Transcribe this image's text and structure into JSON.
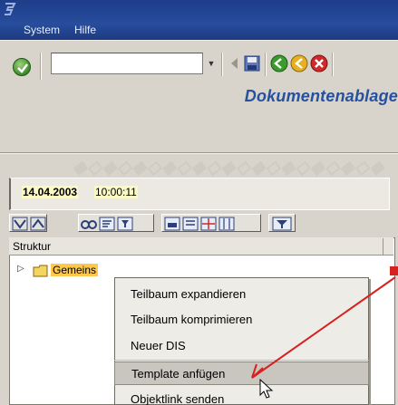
{
  "menubar": {
    "items": [
      "System",
      "Hilfe"
    ]
  },
  "toolbar": {
    "command_field_value": "",
    "buttons": [
      "enter-icon",
      "save-icon",
      "back-icon",
      "exit-icon",
      "cancel-icon"
    ]
  },
  "app": {
    "title": "Dokumentenablage"
  },
  "info": {
    "date": "14.04.2003",
    "time": "10:00:11"
  },
  "tree": {
    "column_header": "Struktur",
    "node_label": "Gemeins"
  },
  "context_menu": {
    "items": [
      "Teilbaum expandieren",
      "Teilbaum komprimieren",
      "Neuer DIS",
      "Template anfügen",
      "Objektlink senden"
    ],
    "highlighted_index": 3
  },
  "colors": {
    "titlebar": "#1e3d8a",
    "app_title": "#2650a0",
    "node_highlight": "#ffc84a",
    "arrow": "#d72020"
  }
}
